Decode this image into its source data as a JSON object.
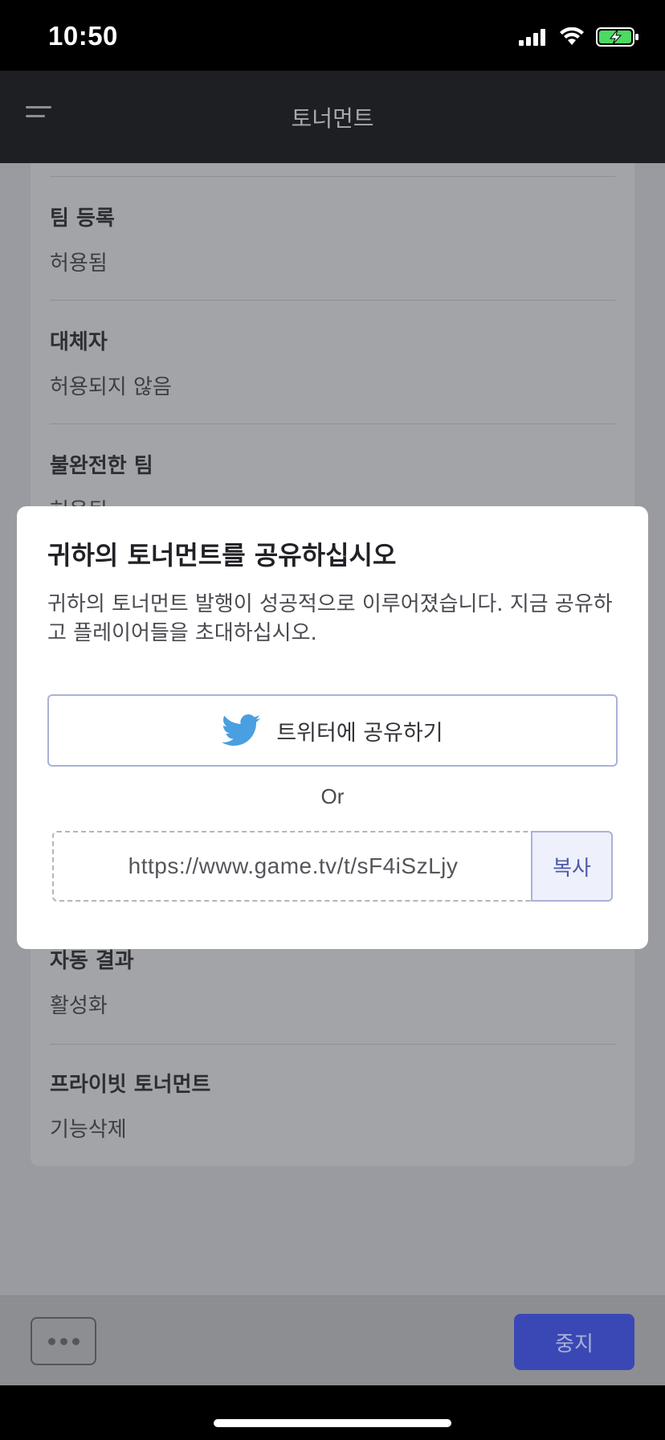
{
  "status": {
    "time": "10:50"
  },
  "header": {
    "title": "토너먼트"
  },
  "settings": [
    {
      "label": "팀 등록",
      "value": "허용됨"
    },
    {
      "label": "대체자",
      "value": "허용되지 않음"
    },
    {
      "label": "불완전한 팀",
      "value": "허용됨"
    },
    {
      "label": "자동 결과",
      "value": "활성화"
    },
    {
      "label": "프라이빗 토너먼트",
      "value": "기능삭제"
    }
  ],
  "modal": {
    "title": "귀하의 토너먼트를 공유하십시오",
    "description": "귀하의 토너먼트 발행이 성공적으로 이루어졌습니다. 지금 공유하고 플레이어들을 초대하십시오.",
    "twitter_label": "트위터에 공유하기",
    "or_label": "Or",
    "url": "https://www.game.tv/t/sF4iSzLjy",
    "copy_label": "복사"
  },
  "bottom": {
    "stop_label": "중지"
  },
  "colors": {
    "accent": "#3a48b5",
    "twitter": "#4a9fe0"
  }
}
